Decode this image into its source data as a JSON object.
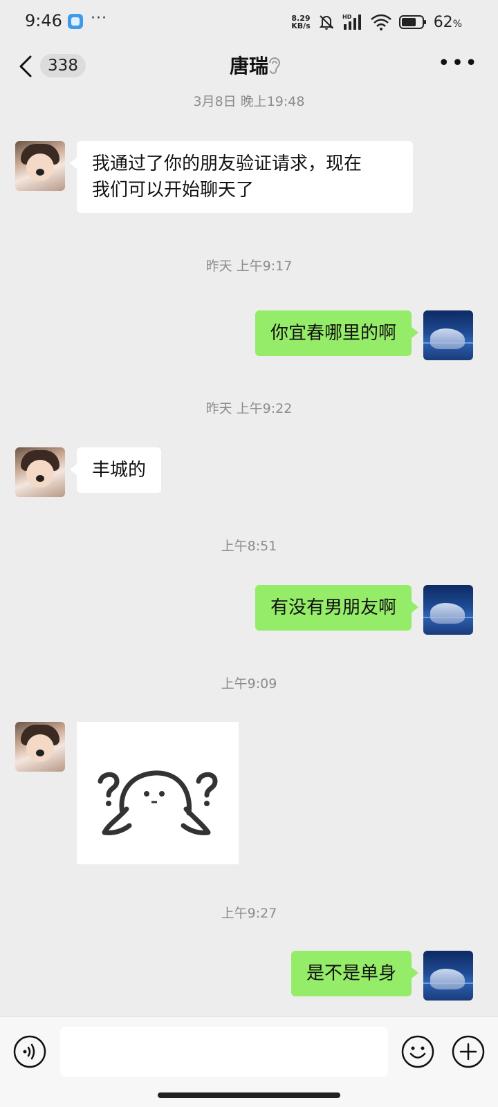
{
  "status_bar": {
    "time": "9:46",
    "net_speed_value": "8.29",
    "net_speed_unit": "KB/s",
    "hd": "HD",
    "battery": "62",
    "battery_unit": "%"
  },
  "header": {
    "back_count": "338",
    "title": "唐瑞"
  },
  "chat": {
    "timestamps": [
      "3月8日 晚上19:48",
      "昨天 上午9:17",
      "昨天 上午9:22",
      "上午8:51",
      "上午9:09",
      "上午9:27"
    ],
    "messages": [
      {
        "side": "in",
        "lines": [
          "我通过了你的朋友验证请求，现在",
          "我们可以开始聊天了"
        ]
      },
      {
        "side": "out",
        "text": "你宜春哪里的啊"
      },
      {
        "side": "in",
        "text": "丰城的"
      },
      {
        "side": "out",
        "text": "有没有男朋友啊"
      },
      {
        "side": "in",
        "sticker": "confused-blob-sticker"
      },
      {
        "side": "out",
        "text": "是不是单身"
      }
    ]
  },
  "input": {
    "placeholder": ""
  },
  "colors": {
    "background": "#ededed",
    "outgoing_bubble": "#95ec69",
    "incoming_bubble": "#ffffff",
    "timestamp_text": "#8b8b8b"
  },
  "icons": [
    "back-arrow-icon",
    "ear-icon",
    "more-icon",
    "voice-icon",
    "emoji-icon",
    "plus-icon"
  ]
}
